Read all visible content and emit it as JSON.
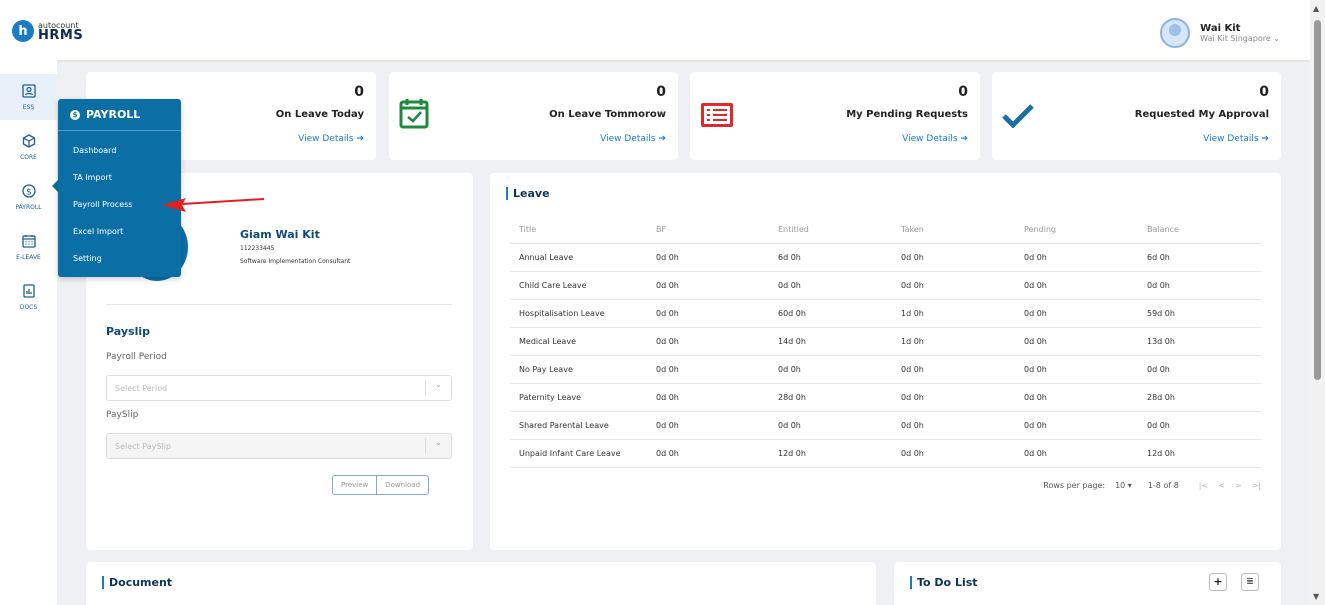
{
  "logo": {
    "small": "autocount",
    "big": "HRMS",
    "mark": "h"
  },
  "user": {
    "name": "Wai Kit",
    "company": "Wai Kit Singapore"
  },
  "sidebar": [
    {
      "label": "ESS",
      "icon": "id-card-icon"
    },
    {
      "label": "CORE",
      "icon": "cube-icon"
    },
    {
      "label": "PAYROLL",
      "icon": "dollar-circle-icon"
    },
    {
      "label": "E-LEAVE",
      "icon": "calendar-icon"
    },
    {
      "label": "DOCS",
      "icon": "document-icon"
    }
  ],
  "flyout": {
    "title": "PAYROLL",
    "items": [
      "Dashboard",
      "TA Import",
      "Payroll Process",
      "Excel Import",
      "Setting"
    ]
  },
  "stats": [
    {
      "value": "0",
      "title": "On Leave Today",
      "link": "View Details"
    },
    {
      "value": "0",
      "title": "On Leave Tommorow",
      "link": "View Details",
      "icon": "calendar-check-icon"
    },
    {
      "value": "0",
      "title": "My Pending Requests",
      "link": "View Details",
      "icon": "list-icon"
    },
    {
      "value": "0",
      "title": "Requested My Approval",
      "link": "View Details",
      "icon": "checkmark-icon"
    }
  ],
  "profile": {
    "name": "Giam Wai Kit",
    "id": "112233445",
    "position": "Software Implementation Consultant"
  },
  "payslip": {
    "title": "Payslip",
    "period_label": "Payroll Period",
    "period_placeholder": "Select Period",
    "payslip_label": "PaySlip",
    "payslip_placeholder": "Select PaySlip",
    "preview": "Preview",
    "download": "Download"
  },
  "leave": {
    "title": "Leave",
    "columns": [
      "Title",
      "BF",
      "Entitled",
      "Taken",
      "Pending",
      "Balance"
    ],
    "rows": [
      [
        "Annual Leave",
        "0d 0h",
        "6d 0h",
        "0d 0h",
        "0d 0h",
        "6d 0h"
      ],
      [
        "Child Care Leave",
        "0d 0h",
        "0d 0h",
        "0d 0h",
        "0d 0h",
        "0d 0h"
      ],
      [
        "Hospitalisation Leave",
        "0d 0h",
        "60d 0h",
        "1d 0h",
        "0d 0h",
        "59d 0h"
      ],
      [
        "Medical Leave",
        "0d 0h",
        "14d 0h",
        "1d 0h",
        "0d 0h",
        "13d 0h"
      ],
      [
        "No Pay Leave",
        "0d 0h",
        "0d 0h",
        "0d 0h",
        "0d 0h",
        "0d 0h"
      ],
      [
        "Paternity Leave",
        "0d 0h",
        "28d 0h",
        "0d 0h",
        "0d 0h",
        "28d 0h"
      ],
      [
        "Shared Parental Leave",
        "0d 0h",
        "0d 0h",
        "0d 0h",
        "0d 0h",
        "0d 0h"
      ],
      [
        "Unpaid Infant Care Leave",
        "0d 0h",
        "12d 0h",
        "0d 0h",
        "0d 0h",
        "12d 0h"
      ]
    ],
    "rows_per_page_label": "Rows per page:",
    "rows_per_page": "10",
    "range": "1-8 of 8"
  },
  "document": {
    "title": "Document"
  },
  "todo": {
    "title": "To Do List"
  },
  "colors": {
    "brand": "#0b6fa6",
    "link": "#1a7dc4",
    "arrow": "#e02020",
    "success": "#1e8a3c",
    "danger": "#e02a2a"
  }
}
